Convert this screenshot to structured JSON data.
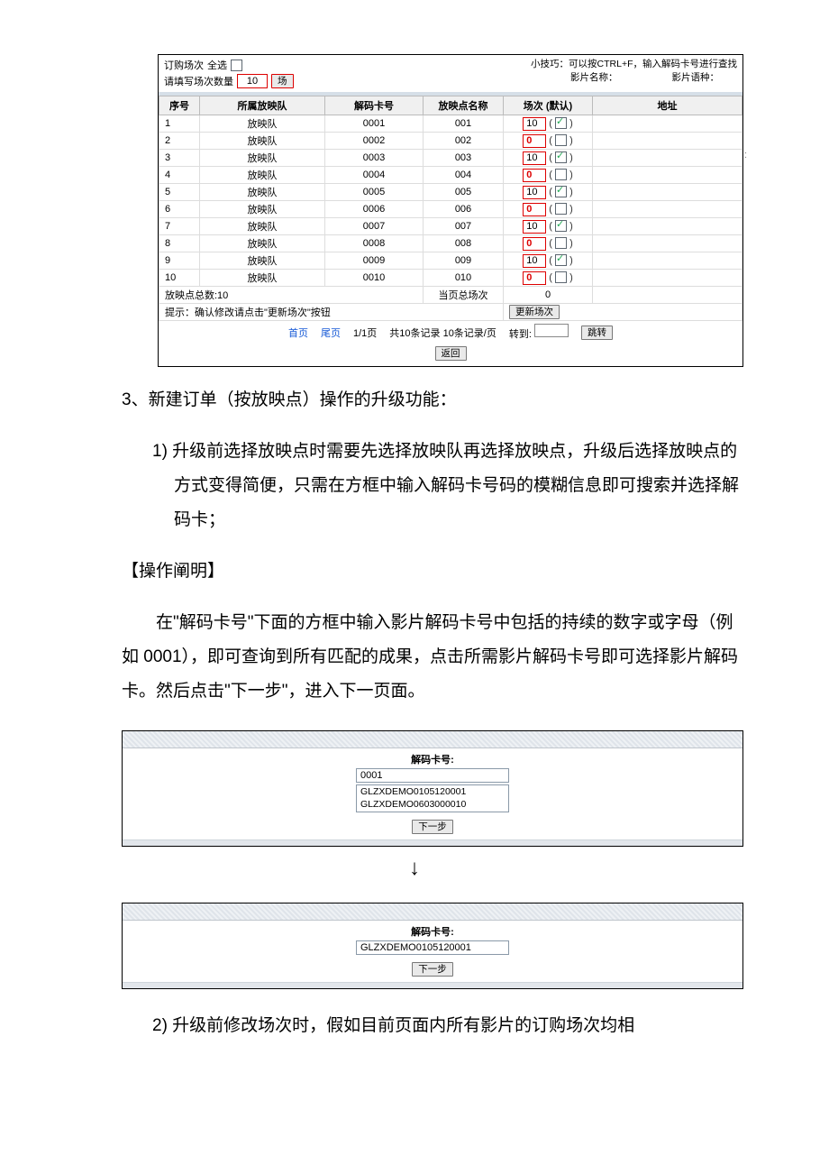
{
  "top_panel": {
    "order_label": "订购场次",
    "select_all_label": "全选",
    "qty_label": "请填写场次数量",
    "qty_value": "10",
    "qty_unit_btn": "场",
    "tip": "小技巧：可以按CTRL+F，输入解码卡号进行查找",
    "movie_name_label": "影片名称：",
    "movie_lang_label": "影片语种："
  },
  "table": {
    "headers": {
      "seq": "序号",
      "team": "所属放映队",
      "card": "解码卡号",
      "point": "放映点名称",
      "sessions": "场次 (默认)",
      "addr": "地址"
    },
    "rows": [
      {
        "seq": "1",
        "team": "放映队",
        "card": "0001",
        "point": "001",
        "val": "10",
        "checked": true
      },
      {
        "seq": "2",
        "team": "放映队",
        "card": "0002",
        "point": "002",
        "val": "0",
        "checked": false
      },
      {
        "seq": "3",
        "team": "放映队",
        "card": "0003",
        "point": "003",
        "val": "10",
        "checked": true
      },
      {
        "seq": "4",
        "team": "放映队",
        "card": "0004",
        "point": "004",
        "val": "0",
        "checked": false
      },
      {
        "seq": "5",
        "team": "放映队",
        "card": "0005",
        "point": "005",
        "val": "10",
        "checked": true
      },
      {
        "seq": "6",
        "team": "放映队",
        "card": "0006",
        "point": "006",
        "val": "0",
        "checked": false
      },
      {
        "seq": "7",
        "team": "放映队",
        "card": "0007",
        "point": "007",
        "val": "10",
        "checked": true
      },
      {
        "seq": "8",
        "team": "放映队",
        "card": "0008",
        "point": "008",
        "val": "0",
        "checked": false
      },
      {
        "seq": "9",
        "team": "放映队",
        "card": "0009",
        "point": "009",
        "val": "10",
        "checked": true
      },
      {
        "seq": "10",
        "team": "放映队",
        "card": "0010",
        "point": "010",
        "val": "0",
        "checked": false
      }
    ],
    "summary": {
      "total_points_label": "放映点总数:10",
      "page_sessions_label": "当页总场次",
      "page_sessions_value": "0"
    },
    "hint": "提示：确认修改请点击\"更新场次\"按钮",
    "update_btn": "更新场次",
    "pager": {
      "first": "首页",
      "last": "尾页",
      "page": "1/1页",
      "count": "共10条记录 10条记录/页",
      "goto_label": "转到:",
      "jump_btn": "跳转"
    },
    "back_btn": "返回"
  },
  "doc": {
    "h3": "3、新建订单（按放映点）操作的升级功能：",
    "li1": "1)  升级前选择放映点时需要先选择放映队再选择放映点，升级后选择放映点的方式变得简便，只需在方框中输入解码卡号码的模糊信息即可搜索并选择解码卡；",
    "op_title": "【操作阐明】",
    "para": "在\"解码卡号\"下面的方框中输入影片解码卡号中包括的持续的数字或字母（例如 0001），即可查询到所有匹配的成果，点击所需影片解码卡号即可选择影片解码卡。然后点击\"下一步\"，进入下一页面。",
    "li2": "2)  升级前修改场次时，假如目前页面内所有影片的订购场次均相"
  },
  "panel_search": {
    "label": "解码卡号:",
    "input_value": "0001",
    "results": [
      "GLZXDEMO0105120001",
      "GLZXDEMO0603000010"
    ],
    "next_btn": "下一步"
  },
  "arrow": "↓",
  "panel_selected": {
    "label": "解码卡号:",
    "input_value": "GLZXDEMO0105120001",
    "next_btn": "下一步"
  }
}
